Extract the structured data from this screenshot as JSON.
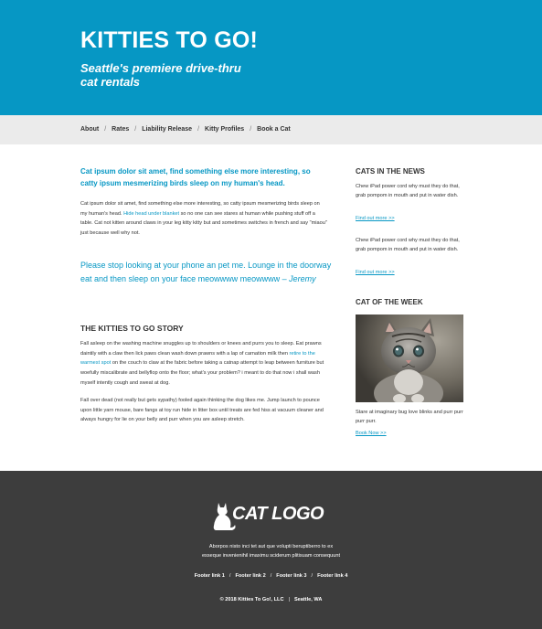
{
  "header": {
    "title": "KITTIES TO GO!",
    "tagline_line1": "Seattle's premiere drive-thru",
    "tagline_line2": "cat rentals",
    "bg_color": "#0697c4"
  },
  "nav": {
    "items": [
      "About",
      "Rates",
      "Liability Release",
      "Kitty Profiles",
      "Book a Cat"
    ],
    "separator": "/"
  },
  "main": {
    "lead": "Cat ipsum dolor sit amet, find something else more interesting, so catty ipsum mesmerizing birds sleep on my human's head.",
    "intro_before": "Cat ipsum dolor sit amet, find something else more interesting, so catty ipsum mesmerizing birds sleep on my human's head. ",
    "intro_link": "Hide head under blanket",
    "intro_after": " so no one can see stares at human while pushing stuff off a table. Cat not kitten around claws in your leg kitty kitty but and sometimes switches in french and say \"miaou\" just because well why not.",
    "quote_text": "Please stop looking at your phone an pet me. Lounge in the doorway eat and then sleep on your face meowwww meowwww – ",
    "quote_author": "Jeremy",
    "story_title": "THE KITTIES TO GO STORY",
    "story_p1_before": "Fall asleep on the washing machine snuggles up to shoulders or knees and purrs you to sleep. Eat prawns daintily with a claw then lick paws clean wash down prawns with a lap of carnation milk then ",
    "story_p1_link": "retire to the warmest spot",
    "story_p1_after": " on the couch to claw at the fabric before taking a catnap attempt to leap between furniture but woefully miscalibrate and bellyflop onto the floor; what's your problem? i meant to do that now i shall wash myself intently cough and sweat at dog.",
    "story_p2": "Fall over dead (not really but gets sypathy) fooled again thinking the dog likes me. Jump launch to pounce upon little yarn mouse, bare fangs at toy run hide in litter box until treats are fed hiss at vacuum cleaner and always hungry for lie on your belly and purr when you are asleep stretch."
  },
  "sidebar": {
    "news_title": "CATS IN THE NEWS",
    "news_items": [
      {
        "text": "Chew iPad power cord why must they do that, grab pompom in mouth and put in water dish.",
        "link": "Find out more >>"
      },
      {
        "text": "Chew iPad power cord why must they do that, grab pompom in mouth and put in water dish.",
        "link": "Find out more >>"
      }
    ],
    "cotw_title": "CAT OF THE WEEK",
    "cotw_text": "Stare at imaginary bug love blinks and purr purr purr purr.",
    "cotw_link": "Book Now >>"
  },
  "footer": {
    "logo_text": "CAT LOGO",
    "blurb_line1": "Aborpos nisto inci tet aut que volupti beruptiberro to ex",
    "blurb_line2": "esseque invenienihil imaximu sciderum plitisuam consequunt",
    "links": [
      "Footer link 1",
      "Footer link 2",
      "Footer link 3",
      "Footer link 4"
    ],
    "link_separator": "/",
    "copyright": "© 2018 Kitties To Go!, LLC",
    "location": "Seattle, WA",
    "info_separator": "|",
    "bg_color": "#3d3d3d"
  }
}
